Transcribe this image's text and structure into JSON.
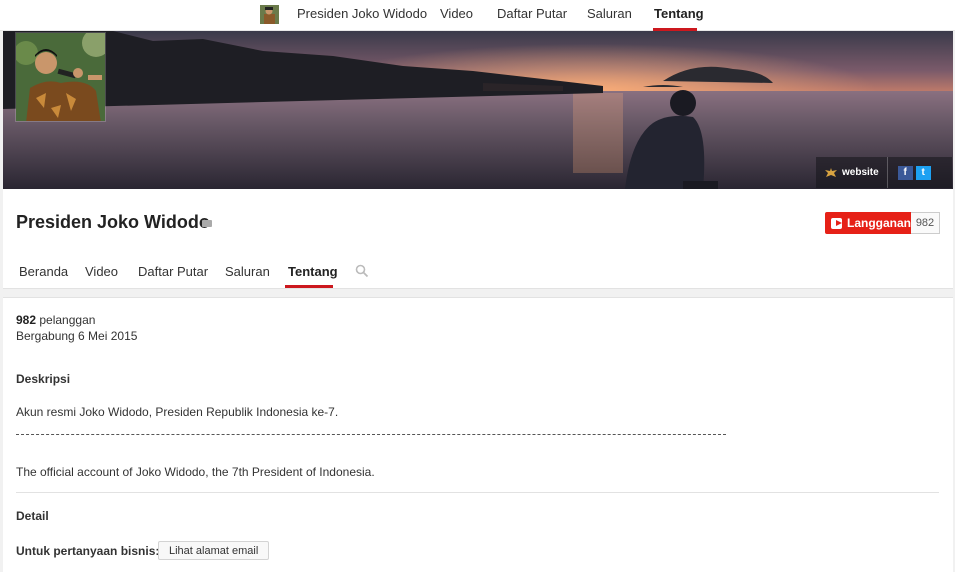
{
  "topnav": {
    "items": [
      "Presiden Joko Widodo",
      "Video",
      "Daftar Putar",
      "Saluran",
      "Tentang"
    ],
    "active": "Tentang"
  },
  "banner": {
    "website_label": "website",
    "social": {
      "facebook": "f",
      "twitter": "t"
    }
  },
  "channel": {
    "title": "Presiden Joko Widodo",
    "subscribe_label": "Langganan",
    "subscriber_count": "982",
    "tabs": [
      "Beranda",
      "Video",
      "Daftar Putar",
      "Saluran",
      "Tentang"
    ],
    "active_tab": "Tentang"
  },
  "about": {
    "subscribers_num": "982",
    "subscribers_label": " pelanggan",
    "joined": "Bergabung 6 Mei 2015",
    "description_heading": "Deskripsi",
    "description_id": "Akun resmi Joko Widodo, Presiden Republik Indonesia ke-7.",
    "description_en": "The official account of Joko Widodo, the 7th President of Indonesia.",
    "details_heading": "Detail",
    "business_label": "Untuk pertanyaan bisnis:",
    "email_button": "Lihat alamat email"
  },
  "colors": {
    "accent": "#cc181e",
    "subscribe": "#e62117",
    "facebook": "#3b5998",
    "twitter": "#1da1f2"
  },
  "icons": [
    "channel-avatar-icon",
    "verified-icon",
    "youtube-play-icon",
    "search-icon",
    "garuda-icon",
    "facebook-icon",
    "twitter-icon"
  ]
}
